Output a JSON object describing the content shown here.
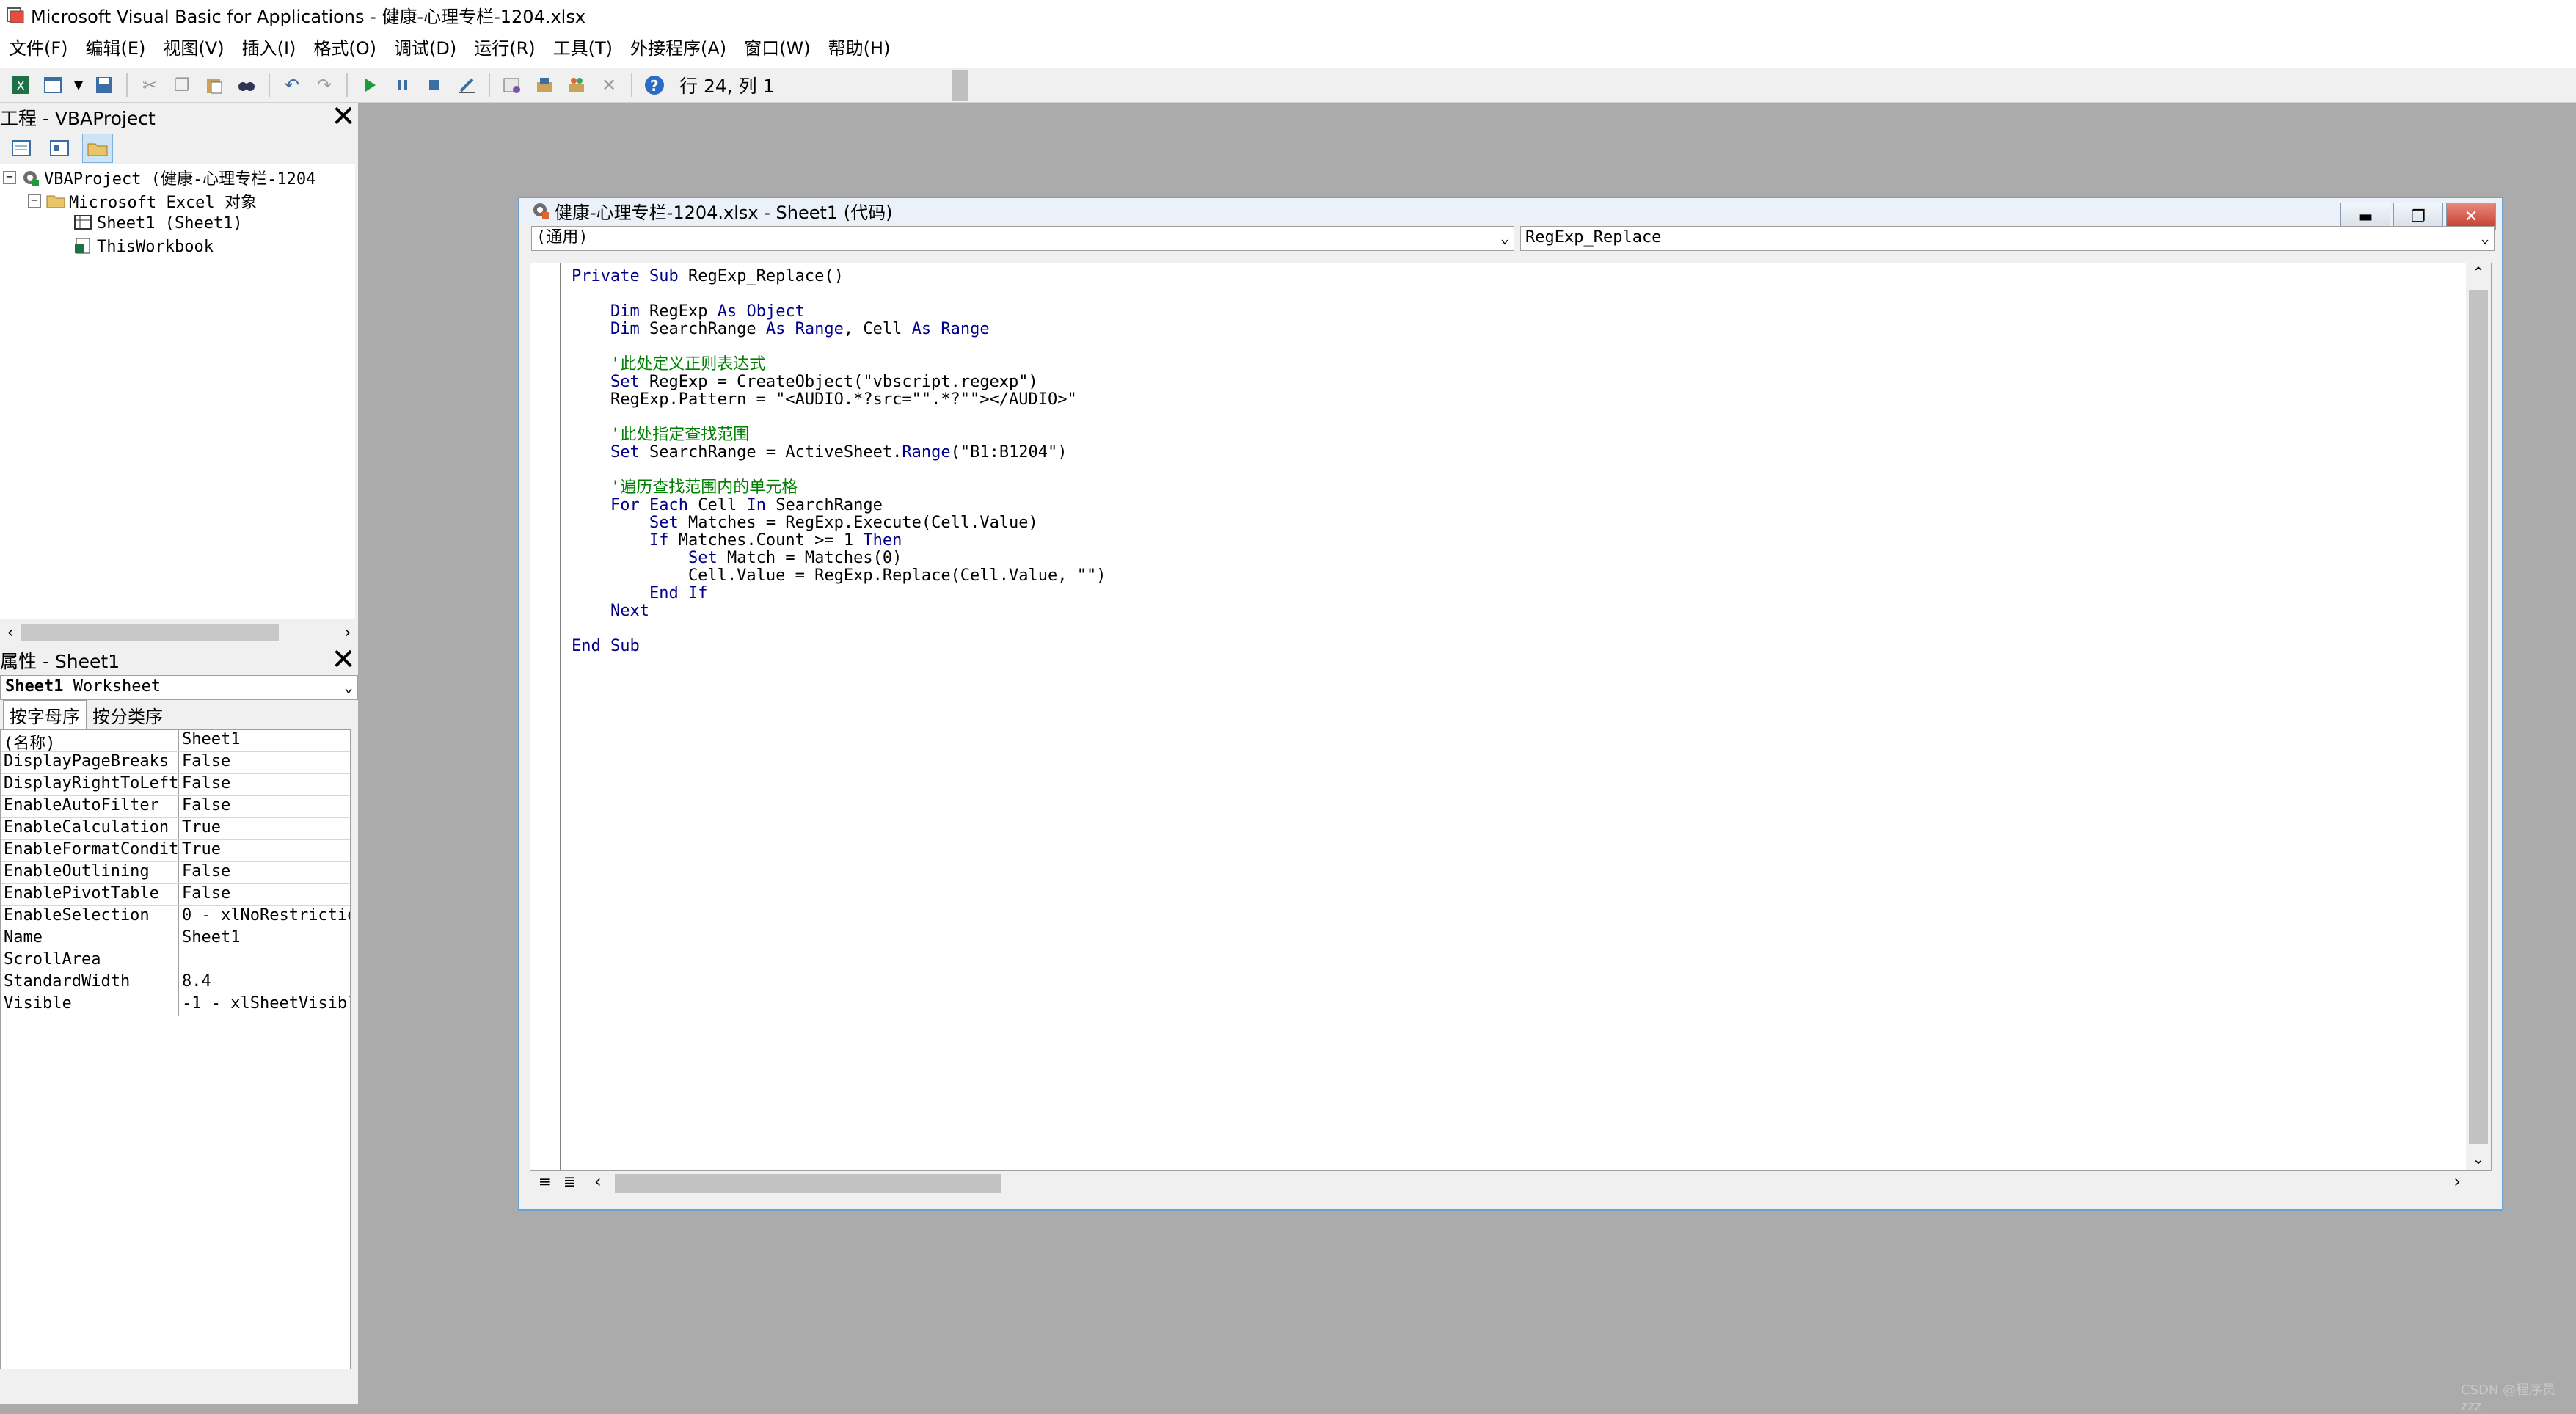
{
  "window": {
    "title": "Microsoft Visual Basic for Applications - 健康-心理专栏-1204.xlsx"
  },
  "menu": [
    "文件(F)",
    "编辑(E)",
    "视图(V)",
    "插入(I)",
    "格式(O)",
    "调试(D)",
    "运行(R)",
    "工具(T)",
    "外接程序(A)",
    "窗口(W)",
    "帮助(H)"
  ],
  "toolbar": {
    "status": "行 24, 列 1",
    "icons": [
      "excel-icon",
      "insert-userform-icon",
      "dropdown-arrow-icon",
      "save-icon",
      "cut-icon",
      "copy-icon",
      "paste-icon",
      "find-icon",
      "undo-icon",
      "redo-icon",
      "run-icon",
      "break-icon",
      "reset-icon",
      "design-mode-icon",
      "project-explorer-icon",
      "properties-icon",
      "object-browser-icon",
      "toolbox-icon",
      "help-icon"
    ]
  },
  "project_pane": {
    "title": "工程 - VBAProject",
    "tree": {
      "root": "VBAProject (健康-心理专栏-1204",
      "folder": "Microsoft Excel 对象",
      "sheet": "Sheet1 (Sheet1)",
      "workbook": "ThisWorkbook"
    }
  },
  "properties_pane": {
    "title": "属性 - Sheet1",
    "object_name": "Sheet1",
    "object_type": "Worksheet",
    "tabs": [
      "按字母序",
      "按分类序"
    ],
    "rows": [
      {
        "name": "(名称)",
        "value": "Sheet1"
      },
      {
        "name": "DisplayPageBreaks",
        "value": "False"
      },
      {
        "name": "DisplayRightToLeft",
        "value": "False"
      },
      {
        "name": "EnableAutoFilter",
        "value": "False"
      },
      {
        "name": "EnableCalculation",
        "value": "True"
      },
      {
        "name": "EnableFormatCondit",
        "value": "True"
      },
      {
        "name": "EnableOutlining",
        "value": "False"
      },
      {
        "name": "EnablePivotTable",
        "value": "False"
      },
      {
        "name": "EnableSelection",
        "value": "0 - xlNoRestrictio"
      },
      {
        "name": "Name",
        "value": "Sheet1"
      },
      {
        "name": "ScrollArea",
        "value": ""
      },
      {
        "name": "StandardWidth",
        "value": "8.4"
      },
      {
        "name": "Visible",
        "value": "-1 - xlSheetVisibl"
      }
    ]
  },
  "code_window": {
    "title": "健康-心理专栏-1204.xlsx - Sheet1 (代码)",
    "object_combo": "(通用)",
    "proc_combo": "RegExp_Replace",
    "lines": [
      {
        "t": "Private Sub RegExp_Replace()",
        "k": "kw-start"
      },
      {
        "t": "",
        "k": "plain"
      },
      {
        "t": "    Dim RegExp As Object",
        "k": "dim"
      },
      {
        "t": "    Dim SearchRange As Range, Cell As Range",
        "k": "dim"
      },
      {
        "t": "",
        "k": "plain"
      },
      {
        "t": "    '此处定义正则表达式",
        "k": "comment"
      },
      {
        "t": "    Set RegExp = CreateObject(\"vbscript.regexp\")",
        "k": "set"
      },
      {
        "t": "    RegExp.Pattern = \"<AUDIO.*?src=\"\".*?\"\"></AUDIO>\"",
        "k": "plain"
      },
      {
        "t": "",
        "k": "plain"
      },
      {
        "t": "    '此处指定查找范围",
        "k": "comment"
      },
      {
        "t": "    Set SearchRange = ActiveSheet.Range(\"B1:B1204\")",
        "k": "set"
      },
      {
        "t": "",
        "k": "plain"
      },
      {
        "t": "    '遍历查找范围内的单元格",
        "k": "comment"
      },
      {
        "t": "    For Each Cell In SearchRange",
        "k": "for"
      },
      {
        "t": "        Set Matches = RegExp.Execute(Cell.Value)",
        "k": "set"
      },
      {
        "t": "        If Matches.Count >= 1 Then",
        "k": "if"
      },
      {
        "t": "            Set Match = Matches(0)",
        "k": "set"
      },
      {
        "t": "            Cell.Value = RegExp.Replace(Cell.Value, \"\")",
        "k": "plain"
      },
      {
        "t": "        End If",
        "k": "kwline"
      },
      {
        "t": "    Next",
        "k": "kwline"
      },
      {
        "t": "",
        "k": "plain"
      },
      {
        "t": "End Sub",
        "k": "kwline"
      }
    ]
  },
  "watermark": "CSDN @程序员zzz",
  "colors": {
    "workspace": "#ababab",
    "keyword": "#00008b",
    "comment": "#008000",
    "active_border": "#6ea0d0"
  }
}
